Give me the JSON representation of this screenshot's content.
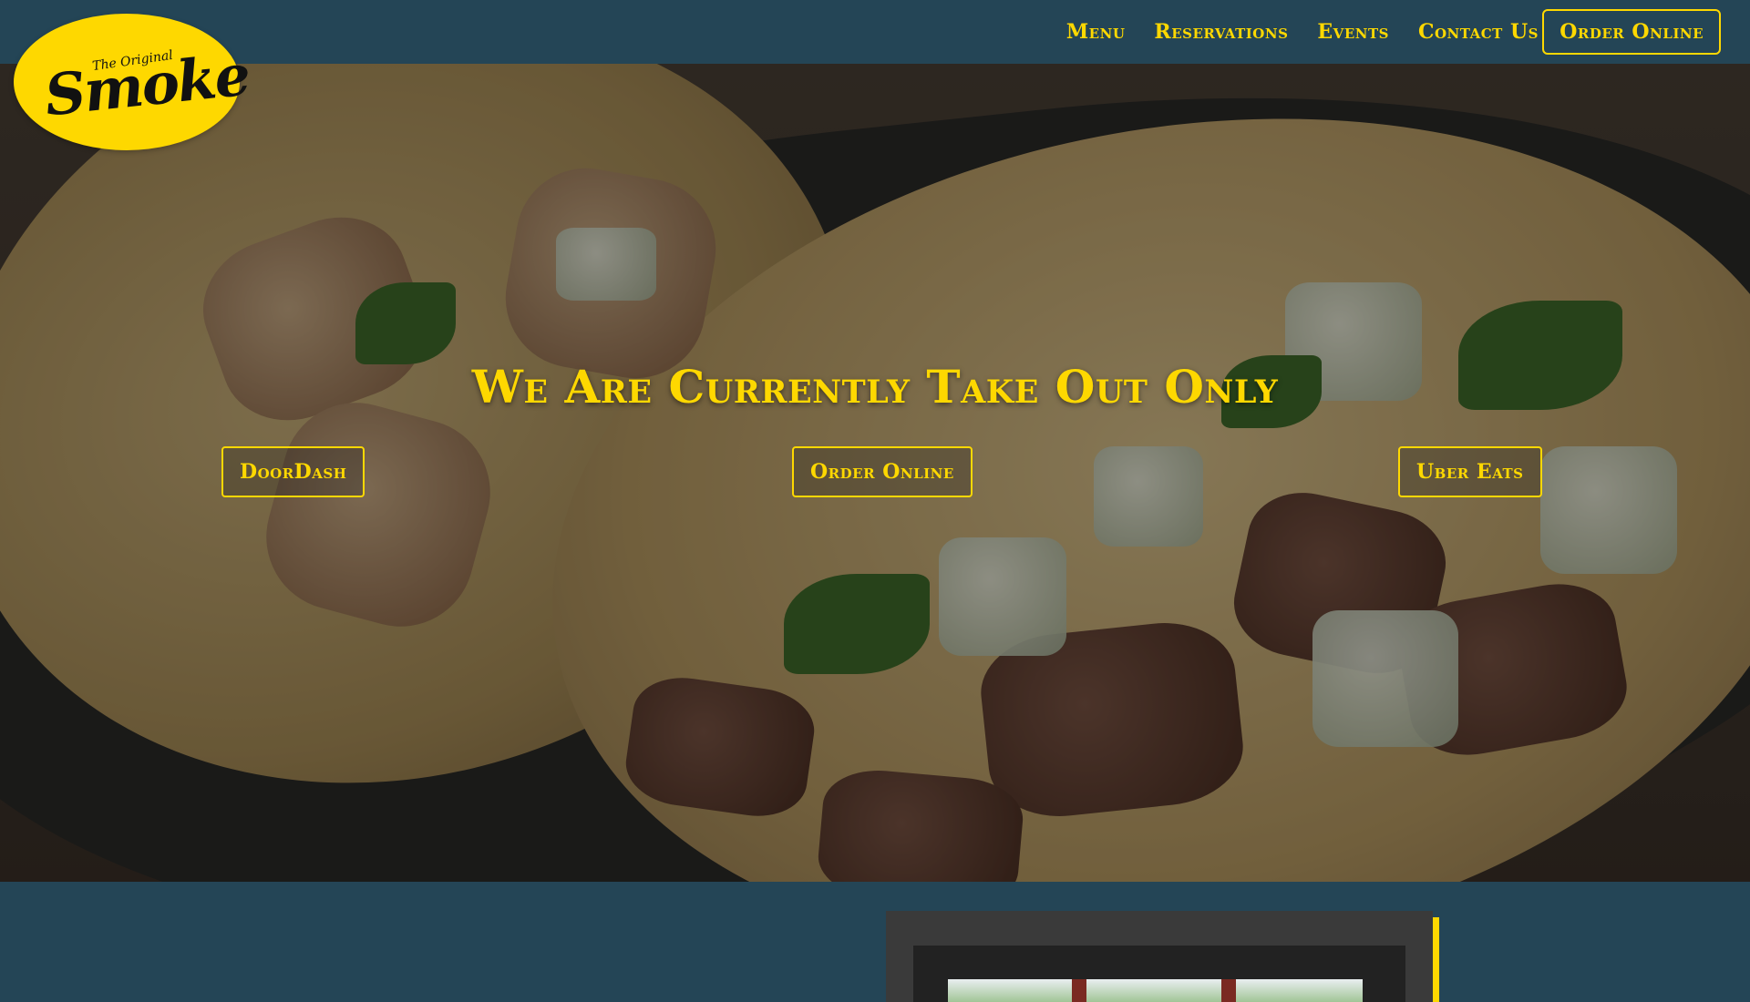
{
  "header": {
    "logo": {
      "small_text": "The Original",
      "main_text": "Smoke"
    },
    "nav": [
      {
        "label": "Menu"
      },
      {
        "label": "Reservations"
      },
      {
        "label": "Events"
      },
      {
        "label": "Contact Us"
      }
    ],
    "order_button": "Order Online"
  },
  "hero": {
    "headline": "We Are Currently Take Out Only",
    "buttons": {
      "doordash": "DoorDash",
      "order_online": "Order Online",
      "uber_eats": "Uber Eats"
    }
  },
  "colors": {
    "header_bg": "#244556",
    "accent": "#fed800"
  }
}
